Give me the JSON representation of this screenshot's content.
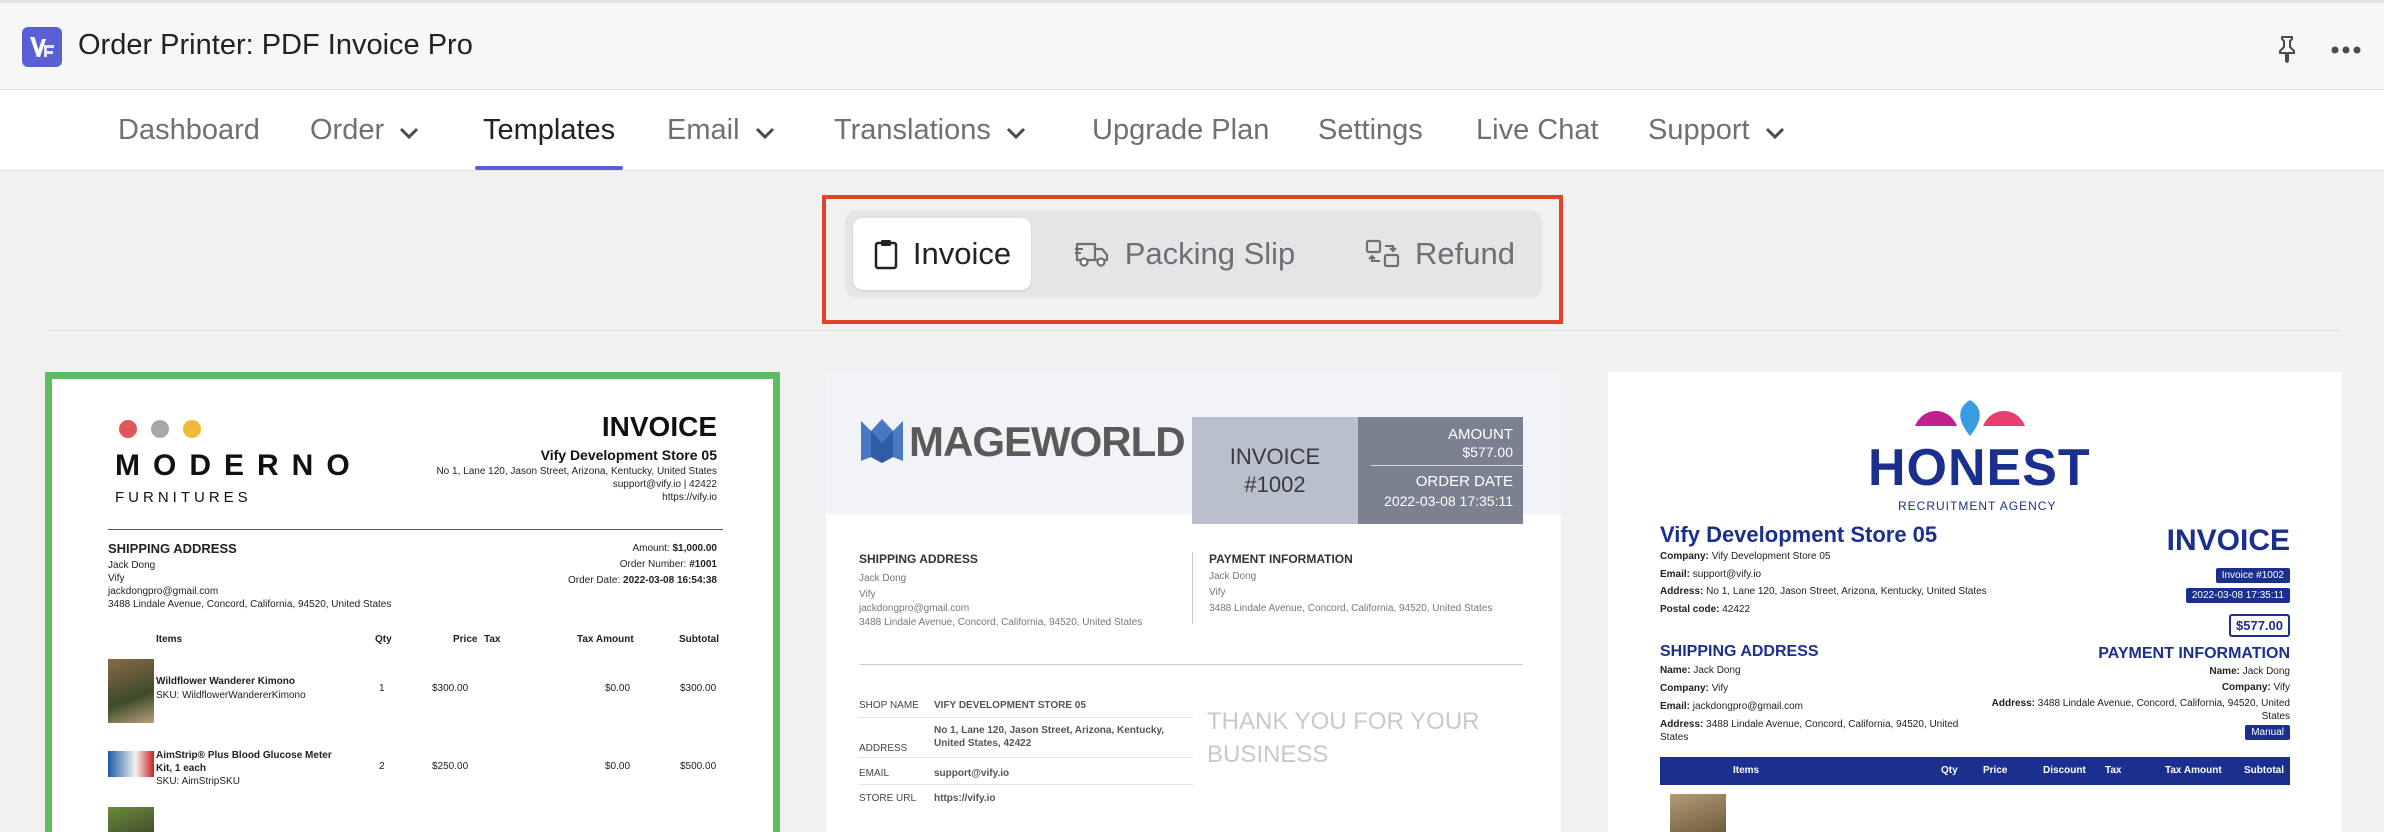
{
  "app": {
    "title": "Order Printer: PDF Invoice Pro",
    "logo_icon": "vify-logo-icon",
    "accent": "#5b5fd6"
  },
  "header_actions": {
    "pin": "pin-icon",
    "more": "more-horizontal-icon"
  },
  "nav": {
    "items": [
      {
        "label": "Dashboard"
      },
      {
        "label": "Order"
      },
      {
        "label": "Templates"
      },
      {
        "label": "Email"
      },
      {
        "label": "Translations"
      },
      {
        "label": "Upgrade Plan"
      },
      {
        "label": "Settings"
      },
      {
        "label": "Live Chat"
      },
      {
        "label": "Support"
      }
    ],
    "active": "Templates"
  },
  "segments": {
    "items": [
      {
        "label": "Invoice",
        "icon": "clipboard-icon"
      },
      {
        "label": "Packing Slip",
        "icon": "truck-icon"
      },
      {
        "label": "Refund",
        "icon": "refund-icon"
      }
    ],
    "selected": "Invoice",
    "highlight_color": "#e2432a"
  },
  "templates": {
    "moderno": {
      "selected_border": "#5dbf62",
      "brand_line1": "MODERNO",
      "brand_line2": "FURNITURES",
      "heading": "INVOICE",
      "store": "Vify Development Store 05",
      "address": "No 1, Lane 120, Jason Street, Arizona, Kentucky, United States",
      "contact": "support@vify.io  |  42422",
      "url": "https://vify.io",
      "ship_title": "SHIPPING ADDRESS",
      "ship_name": "Jack Dong",
      "ship_company": "Vify",
      "ship_email": "jackdongpro@gmail.com",
      "ship_addr": "3488 Lindale Avenue, Concord, California, 94520, United States",
      "amount_label": "Amount:",
      "amount": "$1,000.00",
      "order_label": "Order Number:",
      "order": "#1001",
      "date_label": "Order Date:",
      "date": "2022-03-08 16:54:38",
      "columns": [
        "Items",
        "Qty",
        "Price",
        "Tax",
        "Tax Amount",
        "Subtotal"
      ],
      "rows": [
        {
          "name": "Wildflower Wanderer Kimono",
          "sku": "SKU: WildflowerWandererKimono",
          "qty": "1",
          "price": "$300.00",
          "tax": "",
          "tax_amount": "$0.00",
          "subtotal": "$300.00"
        },
        {
          "name": "AimStrip® Plus Blood Glucose Meter Kit, 1 each",
          "sku": "SKU: AimStripSKU",
          "qty": "2",
          "price": "$250.00",
          "tax": "",
          "tax_amount": "$0.00",
          "subtotal": "$500.00"
        }
      ]
    },
    "mageworld": {
      "brand": "MAGEWORLD",
      "invoice_label": "INVOICE",
      "invoice_no": "#1002",
      "amount_label": "AMOUNT",
      "amount": "$577.00",
      "date_label": "ORDER DATE",
      "date": "2022-03-08 17:35:11",
      "ship_title": "SHIPPING ADDRESS",
      "ship_name": "Jack Dong",
      "ship_company": "Vify",
      "ship_email": "jackdongpro@gmail.com",
      "ship_addr": "3488 Lindale Avenue, Concord, California, 94520, United States",
      "pay_title": "PAYMENT INFORMATION",
      "pay_name": "Jack Dong",
      "pay_company": "Vify",
      "pay_addr": "3488 Lindale Avenue, Concord, California, 94520, United States",
      "shop_name_label": "SHOP NAME",
      "shop_name": "VIFY DEVELOPMENT STORE 05",
      "address_label": "ADDRESS",
      "address": "No 1, Lane 120, Jason Street, Arizona, Kentucky, United States, 42422",
      "email_label": "EMAIL",
      "email": "support@vify.io",
      "store_url_label": "STORE URL",
      "store_url": "https://vify.io",
      "thanks": "THANK YOU FOR YOUR BUSINESS"
    },
    "honest": {
      "brand": "HONEST",
      "tagline": "RECRUITMENT AGENCY",
      "store": "Vify Development Store 05",
      "company_label": "Company:",
      "company": "Vify Development Store 05",
      "email_label": "Email:",
      "email": "support@vify.io",
      "address_label": "Address:",
      "address": "No 1, Lane 120, Jason Street, Arizona, Kentucky, United States",
      "postal_label": "Postal code:",
      "postal": "42422",
      "heading": "INVOICE",
      "invoice_badge": "Invoice #1002",
      "date_badge": "2022-03-08 17:35:11",
      "amount_badge": "$577.00",
      "ship_title": "SHIPPING ADDRESS",
      "ship_name_label": "Name:",
      "ship_name": "Jack Dong",
      "ship_company_label": "Company:",
      "ship_company": "Vify",
      "ship_email_label": "Email:",
      "ship_email": "jackdongpro@gmail.com",
      "ship_address_label": "Address:",
      "ship_address": "3488 Lindale Avenue, Concord, California, 94520, United States",
      "pay_title": "PAYMENT INFORMATION",
      "pay_name_label": "Name:",
      "pay_name": "Jack Dong",
      "pay_company_label": "Company:",
      "pay_company": "Vify",
      "pay_address_label": "Address:",
      "pay_address": "3488 Lindale Avenue, Concord, California, 94520, United States",
      "pay_method": "Manual",
      "columns": [
        "Items",
        "Qty",
        "Price",
        "Discount",
        "Tax",
        "Tax Amount",
        "Subtotal"
      ],
      "theme_color": "#1b2f8f"
    }
  }
}
